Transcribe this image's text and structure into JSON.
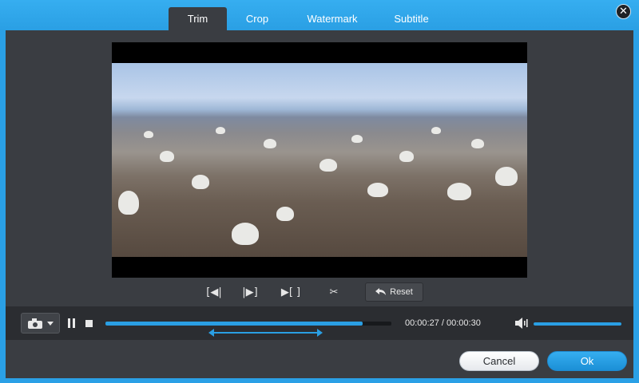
{
  "window": {
    "accent_color": "#2aa0e6"
  },
  "tabs": [
    {
      "label": "Trim",
      "active": true
    },
    {
      "label": "Crop",
      "active": false
    },
    {
      "label": "Watermark",
      "active": false
    },
    {
      "label": "Subtitle",
      "active": false
    }
  ],
  "close": {
    "icon": "close-icon",
    "glyph": "✕"
  },
  "video": {
    "content": "gannet-colony-frame"
  },
  "trim_controls": {
    "set_start_glyph": "[◀|",
    "set_end_glyph": "|▶]",
    "play_segment_glyph": "▶[ ]",
    "cut_glyph": "✂",
    "reset_label": "Reset",
    "reset_icon": "undo-arrow-icon"
  },
  "playback": {
    "snapshot_icon": "camera-icon",
    "current_time": "00:00:27",
    "total_time": "00:00:30",
    "time_text": "00:00:27 / 00:00:30",
    "progress_fraction": 0.9,
    "trim_start_fraction": 0.36,
    "trim_end_fraction": 0.76,
    "volume_fraction": 1.0
  },
  "footer": {
    "cancel_label": "Cancel",
    "ok_label": "Ok"
  }
}
